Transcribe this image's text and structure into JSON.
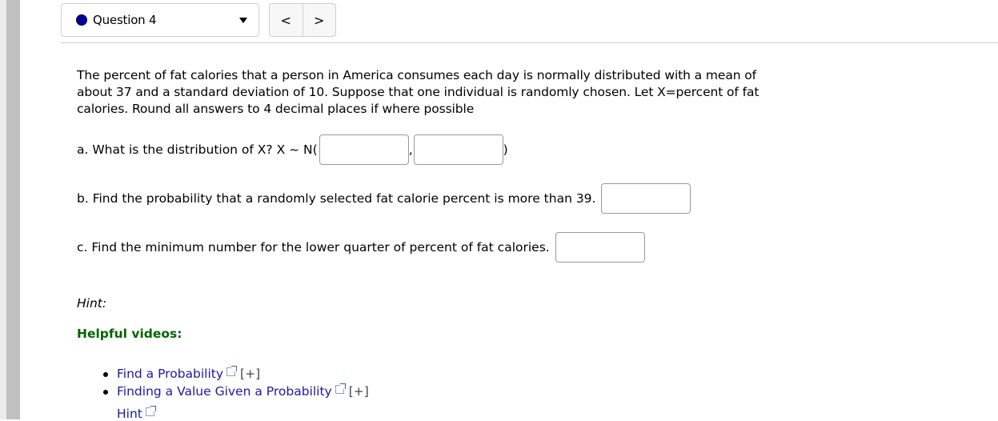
{
  "header": {
    "question_selector": {
      "label": "Question 4",
      "status_color": "#0000a0"
    },
    "nav": {
      "prev": "<",
      "next": ">"
    }
  },
  "question": {
    "intro": "The percent of fat calories that a person in America consumes each day is normally distributed with a mean of about 37 and a standard deviation of 10. Suppose that one individual is randomly chosen. Let X=percent of fat calories. Round all answers to 4 decimal places if where possible",
    "part_a": {
      "label": "a.  What is the distribution of X? X ~ N(",
      "separator": ",",
      "close": ")",
      "input1_value": "",
      "input2_value": ""
    },
    "part_b": {
      "label": "b.  Find the probability that a randomly selected fat calorie percent is more than 39.",
      "input_value": ""
    },
    "part_c": {
      "label": "c.  Find the minimum number for the lower quarter of percent of fat calories.",
      "input_value": ""
    }
  },
  "help": {
    "hint_label": "Hint:",
    "videos_label": "Helpful videos:",
    "videos": [
      {
        "label": "Find a Probability",
        "expand": "[+]"
      },
      {
        "label": "Finding a Value Given a Probability",
        "expand": "[+]"
      }
    ],
    "hint_link": "Hint"
  }
}
